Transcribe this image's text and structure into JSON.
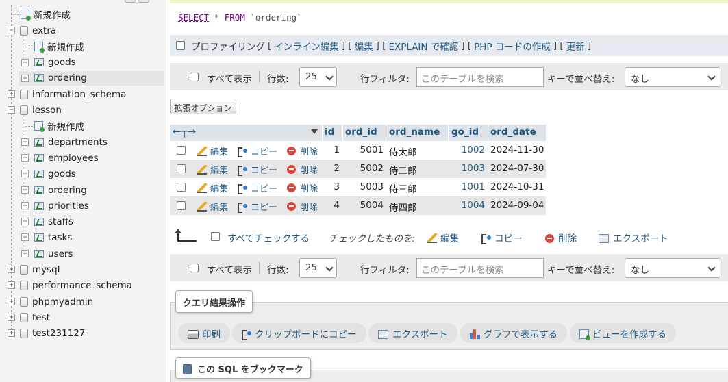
{
  "nav": {
    "items": [
      {
        "label": "新規作成",
        "kind": "new",
        "level": 1
      },
      {
        "label": "extra",
        "kind": "db",
        "level": 0,
        "expanded": true
      },
      {
        "label": "新規作成",
        "kind": "new",
        "level": 1
      },
      {
        "label": "goods",
        "kind": "table",
        "level": 1
      },
      {
        "label": "ordering",
        "kind": "table",
        "level": 1,
        "selected": true
      },
      {
        "label": "information_schema",
        "kind": "db",
        "level": 0
      },
      {
        "label": "lesson",
        "kind": "db",
        "level": 0,
        "expanded": true
      },
      {
        "label": "新規作成",
        "kind": "new",
        "level": 1
      },
      {
        "label": "departments",
        "kind": "table",
        "level": 1
      },
      {
        "label": "employees",
        "kind": "table",
        "level": 1
      },
      {
        "label": "goods",
        "kind": "table",
        "level": 1
      },
      {
        "label": "ordering",
        "kind": "table",
        "level": 1
      },
      {
        "label": "priorities",
        "kind": "table",
        "level": 1
      },
      {
        "label": "staffs",
        "kind": "table",
        "level": 1
      },
      {
        "label": "tasks",
        "kind": "table",
        "level": 1
      },
      {
        "label": "users",
        "kind": "table",
        "level": 1
      },
      {
        "label": "mysql",
        "kind": "db",
        "level": 0
      },
      {
        "label": "performance_schema",
        "kind": "db",
        "level": 0
      },
      {
        "label": "phpmyadmin",
        "kind": "db",
        "level": 0
      },
      {
        "label": "test",
        "kind": "db",
        "level": 0
      },
      {
        "label": "test231127",
        "kind": "db",
        "level": 0
      }
    ]
  },
  "sql": {
    "select": "SELECT",
    "star": "*",
    "from": "FROM",
    "table": "`ordering`"
  },
  "profiling": {
    "label": "プロファイリング",
    "links": [
      "インライン編集",
      "編集",
      "EXPLAIN で確認",
      "PHP コードの作成",
      "更新"
    ]
  },
  "navbar": {
    "show_all": "すべて表示",
    "rows_label": "行数:",
    "rows_value": "25",
    "filter_label": "行フィルタ:",
    "filter_placeholder": "このテーブルを検索",
    "sort_label": "キーで並べ替え:",
    "sort_value": "なし"
  },
  "extended_options": "拡張オプション",
  "table": {
    "columns": [
      "id",
      "ord_id",
      "ord_name",
      "go_id",
      "ord_date"
    ],
    "action_labels": {
      "edit": "編集",
      "copy": "コピー",
      "delete": "削除"
    },
    "rows": [
      {
        "id": "1",
        "ord_id": "5001",
        "ord_name": "侍太郎",
        "go_id": "1002",
        "ord_date": "2024-11-30"
      },
      {
        "id": "2",
        "ord_id": "5002",
        "ord_name": "侍二郎",
        "go_id": "1003",
        "ord_date": "2024-07-30"
      },
      {
        "id": "3",
        "ord_id": "5003",
        "ord_name": "侍三郎",
        "go_id": "1001",
        "ord_date": "2024-10-31"
      },
      {
        "id": "4",
        "ord_id": "5004",
        "ord_name": "侍四郎",
        "go_id": "1004",
        "ord_date": "2024-09-04"
      }
    ]
  },
  "bulk": {
    "check_all": "すべてチェックする",
    "with_selected": "チェックしたものを:",
    "edit": "編集",
    "copy": "コピー",
    "delete": "削除",
    "export": "エクスポート"
  },
  "query_ops": {
    "legend": "クエリ結果操作",
    "buttons": [
      "印刷",
      "クリップボードにコピー",
      "エクスポート",
      "グラフで表示する",
      "ビューを作成する"
    ]
  },
  "bookmark": {
    "legend": "この SQL をブックマーク"
  }
}
